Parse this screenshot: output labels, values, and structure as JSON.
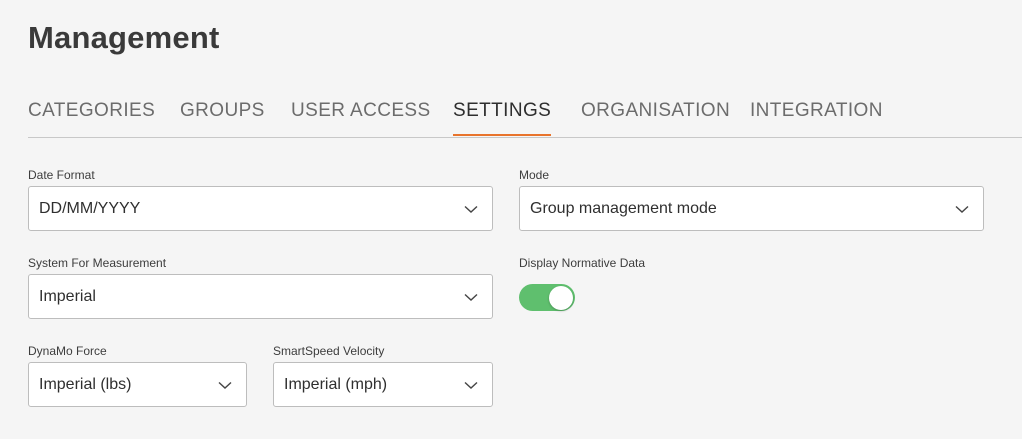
{
  "page": {
    "title": "Management"
  },
  "tabs": [
    {
      "label": "CATEGORIES"
    },
    {
      "label": "GROUPS"
    },
    {
      "label": "USER ACCESS"
    },
    {
      "label": "SETTINGS",
      "active": true
    },
    {
      "label": "ORGANISATION"
    },
    {
      "label": "INTEGRATION"
    }
  ],
  "settings": {
    "date_format": {
      "label": "Date Format",
      "value": "DD/MM/YYYY"
    },
    "mode": {
      "label": "Mode",
      "value": "Group management mode"
    },
    "system_measurement": {
      "label": "System For Measurement",
      "value": "Imperial"
    },
    "normative_data": {
      "label": "Display Normative Data",
      "enabled": true
    },
    "dynamo_force": {
      "label": "DynaMo Force",
      "value": "Imperial (lbs)"
    },
    "smartspeed_velocity": {
      "label": "SmartSpeed Velocity",
      "value": "Imperial (mph)"
    }
  },
  "colors": {
    "accent_tab_underline": "#e8742c",
    "toggle_on": "#5fbf6e",
    "background": "#f5f5f5"
  },
  "icons": {
    "dropdown": "chevron-down-icon"
  }
}
